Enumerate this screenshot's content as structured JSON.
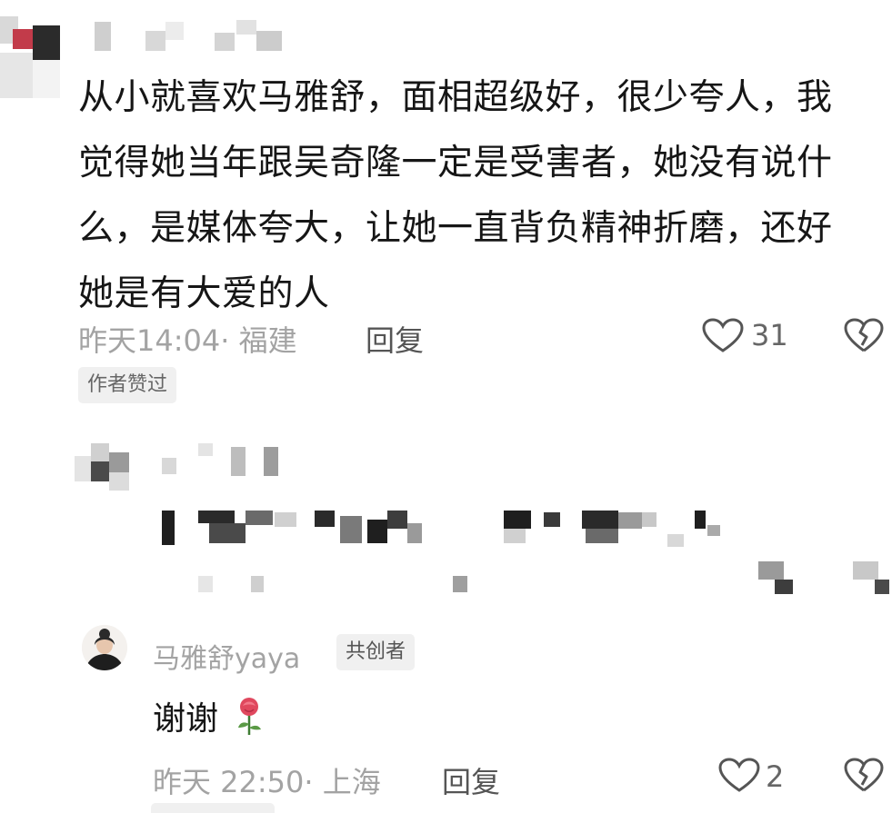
{
  "top_comment": {
    "lines": [
      "从小就喜欢马雅舒，面相超级好，很少夸人，我",
      "觉得她当年跟吴奇隆一定是受害者，她没有说什",
      "么，是媒体夸大，让她一直背负精神折磨，还好",
      "她是有大爱的人"
    ],
    "time": "昨天14:04",
    "location": "· 福建",
    "reply_label": "回复",
    "like_count": "31",
    "author_tag": "作者赞过"
  },
  "reply": {
    "author": "马雅舒yaya",
    "badge": "共创者",
    "text": "谢谢",
    "emoji": "🌹",
    "time": "昨天 22:50",
    "location": "· 上海",
    "reply_label": "回复",
    "like_count": "2"
  },
  "colors": {
    "text": "#161616",
    "meta": "#a3a3a3",
    "tag_bg": "#f0f0f0",
    "mosaic_dark": "#1f1f1f",
    "mosaic_gray": "#bdbdbd"
  },
  "icons": [
    "heart-icon",
    "broken-heart-icon",
    "rose-icon"
  ]
}
